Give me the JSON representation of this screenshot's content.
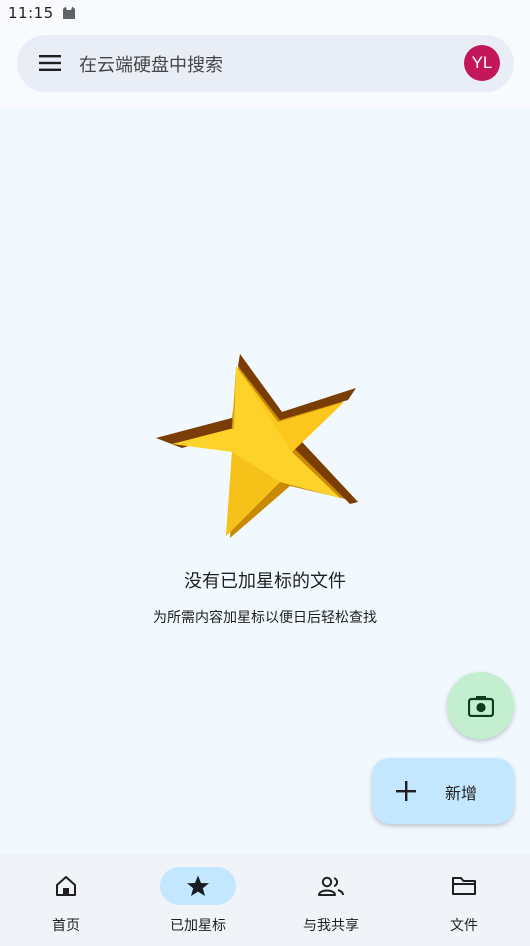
{
  "status_bar": {
    "time": "11:15",
    "notification_icon": "cat-icon"
  },
  "search": {
    "placeholder": "在云端硬盘中搜索",
    "menu_icon": "menu-icon"
  },
  "account": {
    "initials": "YL",
    "avatar_color": "#c2185b"
  },
  "empty_state": {
    "illustration": "star-icon",
    "title": "没有已加星标的文件",
    "subtitle": "为所需内容加星标以便日后轻松查找"
  },
  "fabs": {
    "camera_icon": "camera-icon",
    "new_label": "新增",
    "new_icon": "plus-icon"
  },
  "bottom_nav": {
    "items": [
      {
        "label": "首页",
        "icon": "home-icon",
        "active": false
      },
      {
        "label": "已加星标",
        "icon": "star-icon",
        "active": true
      },
      {
        "label": "与我共享",
        "icon": "people-icon",
        "active": false
      },
      {
        "label": "文件",
        "icon": "folder-icon",
        "active": false
      }
    ]
  },
  "colors": {
    "background": "#f1f9fe",
    "search_bar": "#e9eef6",
    "active_indicator": "#c2e7ff",
    "camera_fab": "#c4eed0",
    "new_fab": "#c2e7ff",
    "nav_bar": "#f0f4f9"
  }
}
